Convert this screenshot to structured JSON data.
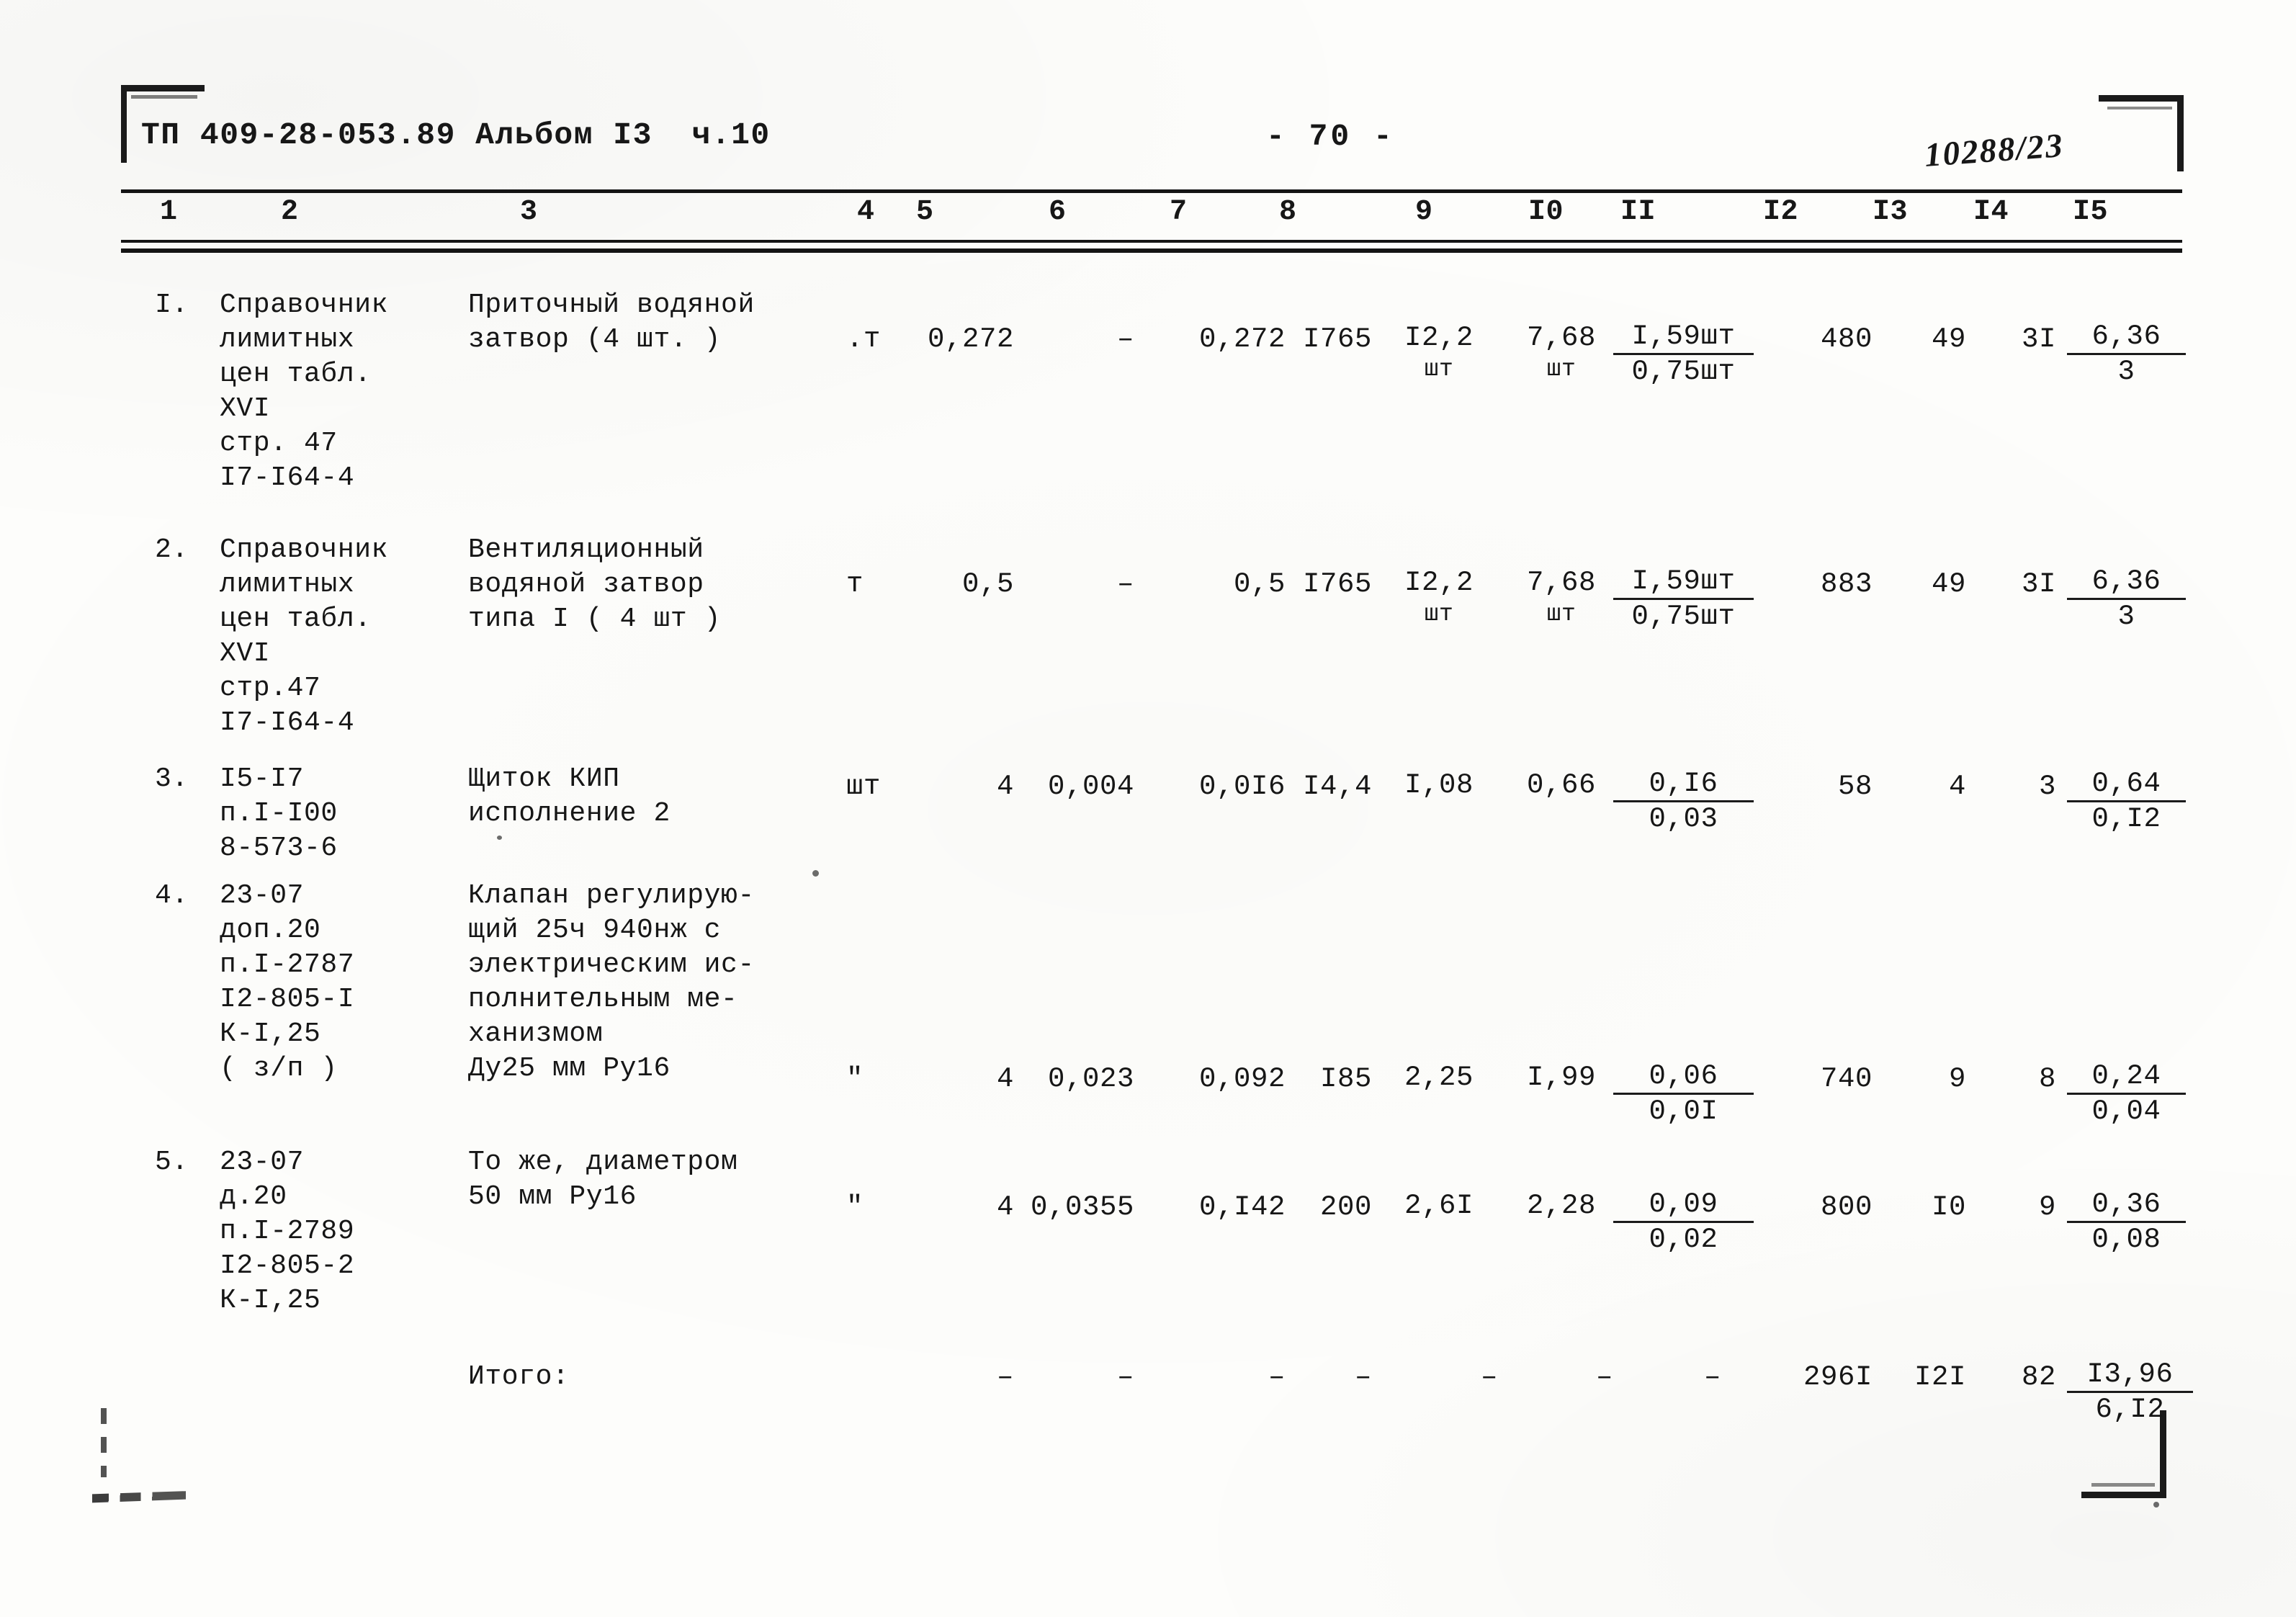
{
  "document": {
    "doc_code": "ТП 409-28-053.89 Альбом I3  ч.10",
    "page_number": "- 70 -",
    "stamp_number": "10288/23"
  },
  "table": {
    "column_numbers": [
      "1",
      "2",
      "3",
      "4",
      "5",
      "6",
      "7",
      "8",
      "9",
      "I0",
      "II",
      "I2",
      "I3",
      "I4",
      "I5"
    ],
    "rows": [
      {
        "index": "I.",
        "col2_lines": [
          "Справочник",
          "лимитных",
          "цен табл.",
          "ХVI",
          "стр. 47",
          "I7-I64-4"
        ],
        "col3_lines": [
          "Приточный водяной",
          "затвор (4 шт. )"
        ],
        "col4_unit": ".т",
        "col5": "0,272",
        "col6": "–",
        "col7": "0,272",
        "col8": "I765",
        "col9_value": "I2,2",
        "col9_unit": "шт",
        "col10_value": "7,68",
        "col11_unit_top": "I,59шт",
        "col11_unit_bot": "0,75шт",
        "col10_unit": "шт",
        "col12": "480",
        "col13": "49",
        "col14": "3I",
        "col15_top": "6,36",
        "col15_bot": "3"
      },
      {
        "index": "2.",
        "col2_lines": [
          "Справочник",
          "лимитных",
          "цен табл.",
          "ХVI",
          "стр.47",
          "I7-I64-4"
        ],
        "col3_lines": [
          "Вентиляционный",
          "водяной затвор",
          "типа I ( 4 шт )"
        ],
        "col4_unit": "т",
        "col5": "0,5",
        "col6": "–",
        "col7": "0,5",
        "col8": "I765",
        "col9_value": "I2,2",
        "col9_unit": "шт",
        "col10_value": "7,68",
        "col10_unit": "шт",
        "col11_unit_top": "I,59шт",
        "col11_unit_bot": "0,75шт",
        "col12": "883",
        "col13": "49",
        "col14": "3I",
        "col15_top": "6,36",
        "col15_bot": "3"
      },
      {
        "index": "3.",
        "col2_lines": [
          "I5-I7",
          "п.I-I00",
          "8-573-6"
        ],
        "col3_lines": [
          "Щиток КИП",
          "исполнение 2"
        ],
        "col4_unit": "шт",
        "col5": "4",
        "col6": "0,004",
        "col7": "0,0I6",
        "col8": "I4,4",
        "col9_value": "I,08",
        "col9_unit": "",
        "col10_value": "0,66",
        "col10_unit": "",
        "col11_unit_top": "0,I6",
        "col11_unit_bot": "0,03",
        "col12": "58",
        "col13": "4",
        "col14": "3",
        "col15_top": "0,64",
        "col15_bot": "0,I2"
      },
      {
        "index": "4.",
        "col2_lines": [
          "23-07",
          "доп.20",
          "п.I-2787",
          "I2-805-I",
          "К-I,25",
          "( з/п )"
        ],
        "col3_lines": [
          "Клапан регулирую-",
          "щий 25ч 940нж с",
          "электрическим ис-",
          "полнительным ме-",
          "ханизмом",
          "Ду25 мм Ру16"
        ],
        "col4_unit": "\"",
        "col5": "4",
        "col6": "0,023",
        "col7": "0,092",
        "col8": "I85",
        "col9_value": "2,25",
        "col9_unit": "",
        "col10_value": "I,99",
        "col10_unit": "",
        "col11_unit_top": "0,06",
        "col11_unit_bot": "0,0I",
        "col12": "740",
        "col13": "9",
        "col14": "8",
        "col15_top": "0,24",
        "col15_bot": "0,04"
      },
      {
        "index": "5.",
        "col2_lines": [
          "23-07",
          "д.20",
          "п.I-2789",
          "I2-805-2",
          "К-I,25"
        ],
        "col3_lines": [
          "То же, диаметром",
          "50 мм Ру16"
        ],
        "col4_unit": "\"",
        "col5": "4",
        "col6": "0,0355",
        "col7": "0,I42",
        "col8": "200",
        "col9_value": "2,6I",
        "col9_unit": "",
        "col10_value": "2,28",
        "col10_unit": "",
        "col11_unit_top": "0,09",
        "col11_unit_bot": "0,02",
        "col12": "800",
        "col13": "I0",
        "col14": "9",
        "col15_top": "0,36",
        "col15_bot": "0,08"
      }
    ],
    "total_row": {
      "label": "Итого:",
      "col5": "–",
      "col6": "–",
      "col7": "–",
      "col8": "–",
      "col9": "–",
      "col10": "–",
      "col11": "–",
      "col12": "296I",
      "col13": "I2I",
      "col14": "82",
      "col15_top": "I3,96",
      "col15_bot": "6,I2"
    }
  }
}
